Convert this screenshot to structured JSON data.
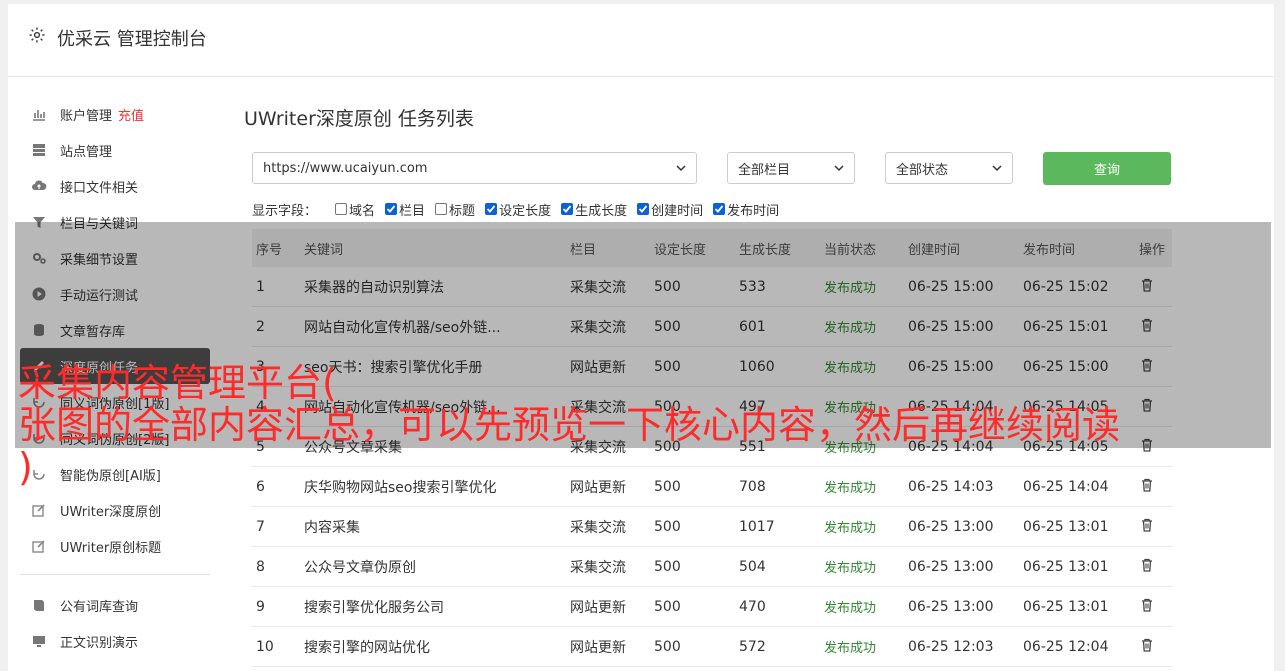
{
  "header": {
    "title": "优采云 管理控制台",
    "icon": "gear-icon"
  },
  "sidebar": {
    "items": [
      {
        "label": "账户管理",
        "extra": "充值",
        "icon": "bar-chart-icon"
      },
      {
        "label": "站点管理",
        "icon": "server-icon"
      },
      {
        "label": "接口文件相关",
        "icon": "cloud-upload-icon"
      },
      {
        "label": "栏目与关键词",
        "icon": "filter-icon"
      },
      {
        "label": "采集细节设置",
        "icon": "gears-icon"
      },
      {
        "label": "手动运行测试",
        "icon": "play-icon"
      },
      {
        "label": "文章暂存库",
        "icon": "database-icon"
      },
      {
        "label": "深度原创任务",
        "icon": "edit-icon",
        "active": true
      },
      {
        "label": "同义词伪原创[1版]",
        "icon": "refresh-icon"
      },
      {
        "label": "同义词伪原创[2版]",
        "icon": "refresh-icon"
      },
      {
        "label": "智能伪原创[AI版]",
        "icon": "refresh-icon"
      },
      {
        "label": "UWriter深度原创",
        "icon": "pencil-square-icon"
      },
      {
        "label": "UWriter原创标题",
        "icon": "pencil-square-icon"
      }
    ],
    "items2": [
      {
        "label": "公有词库查询",
        "icon": "book-icon"
      },
      {
        "label": "正文识别演示",
        "icon": "monitor-icon"
      }
    ]
  },
  "main": {
    "title": "UWriter深度原创 任务列表",
    "site_select": "https://www.ucaiyun.com",
    "column_select": "全部栏目",
    "status_select": "全部状态",
    "query_label": "查询",
    "fields_label": "显示字段：",
    "fields": [
      {
        "label": "域名",
        "checked": false
      },
      {
        "label": "栏目",
        "checked": true
      },
      {
        "label": "标题",
        "checked": false
      },
      {
        "label": "设定长度",
        "checked": true
      },
      {
        "label": "生成长度",
        "checked": true
      },
      {
        "label": "创建时间",
        "checked": true
      },
      {
        "label": "发布时间",
        "checked": true
      }
    ],
    "table": {
      "headers": [
        "序号",
        "关键词",
        "栏目",
        "设定长度",
        "生成长度",
        "当前状态",
        "创建时间",
        "发布时间",
        "操作"
      ],
      "rows": [
        [
          "1",
          "采集器的自动识别算法",
          "采集交流",
          "500",
          "533",
          "发布成功",
          "06-25 15:00",
          "06-25 15:02"
        ],
        [
          "2",
          "网站自动化宣传机器/seo外链...",
          "采集交流",
          "500",
          "601",
          "发布成功",
          "06-25 15:00",
          "06-25 15:01"
        ],
        [
          "3",
          "seo天书：搜索引擎优化手册",
          "网站更新",
          "500",
          "1060",
          "发布成功",
          "06-25 15:00",
          "06-25 15:00"
        ],
        [
          "4",
          "网站自动化宣传机器/seo外链...",
          "采集交流",
          "500",
          "497",
          "发布成功",
          "06-25 14:04",
          "06-25 14:05"
        ],
        [
          "5",
          "公众号文章采集",
          "采集交流",
          "500",
          "551",
          "发布成功",
          "06-25 14:04",
          "06-25 14:05"
        ],
        [
          "6",
          "庆华购物网站seo搜索引擎优化",
          "网站更新",
          "500",
          "708",
          "发布成功",
          "06-25 14:03",
          "06-25 14:04"
        ],
        [
          "7",
          "内容采集",
          "采集交流",
          "500",
          "1017",
          "发布成功",
          "06-25 13:00",
          "06-25 13:01"
        ],
        [
          "8",
          "公众号文章伪原创",
          "采集交流",
          "500",
          "504",
          "发布成功",
          "06-25 13:00",
          "06-25 13:01"
        ],
        [
          "9",
          "搜索引擎优化服务公司",
          "网站更新",
          "500",
          "470",
          "发布成功",
          "06-25 13:00",
          "06-25 13:01"
        ],
        [
          "10",
          "搜索引擎的网站优化",
          "网站更新",
          "500",
          "572",
          "发布成功",
          "06-25 12:03",
          "06-25 12:04"
        ]
      ]
    }
  },
  "banner": {
    "line1": "采集内容管理平台(",
    "line2": "张图的全部内容汇总，可以先预览一下核心内容，然后再继续阅读",
    "line3": ")"
  },
  "colors": {
    "accent_green": "#5cb85c",
    "recharge_red": "#ee3333",
    "banner_red": "#ff2a2a",
    "status_green": "#2e8b2e"
  }
}
